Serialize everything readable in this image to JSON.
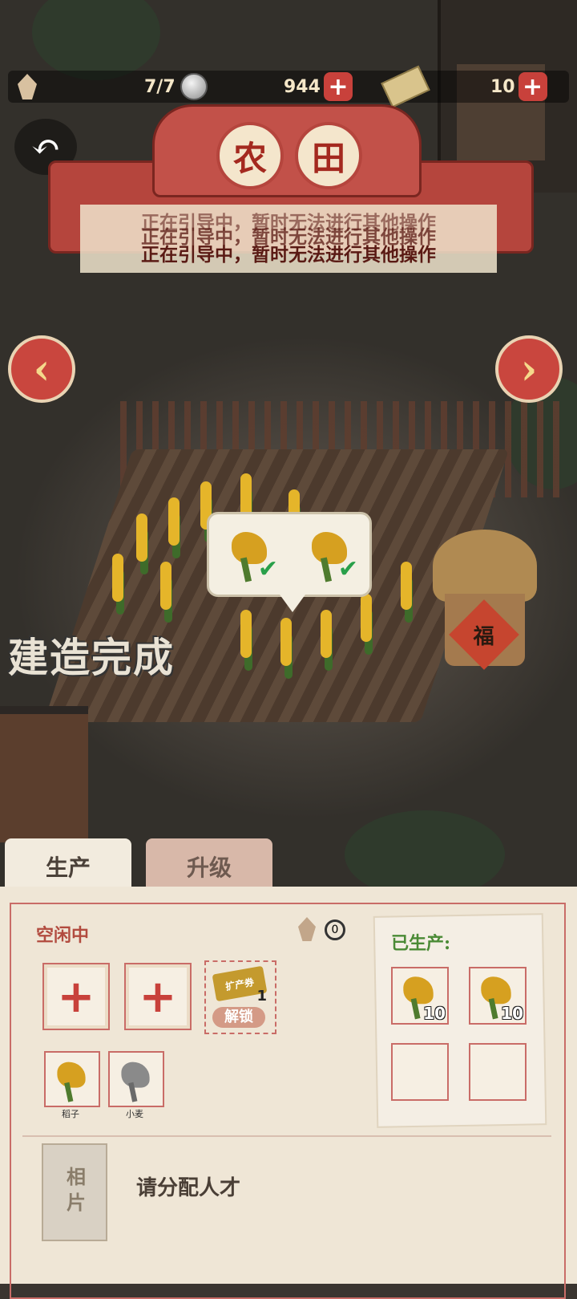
{
  "header": {
    "stamina": "7/7",
    "coins": "944",
    "tickets": "10"
  },
  "title": [
    "农",
    "田"
  ],
  "guide_text": "正在引导中，暂时无法进行其他操作",
  "build_status": "建造完成",
  "hut_sign": "福",
  "tabs": [
    {
      "label": "生产",
      "active": true
    },
    {
      "label": "升级",
      "active": false
    }
  ],
  "production": {
    "status": "空闲中",
    "workers": "0",
    "add_slots": [
      "+",
      "+"
    ],
    "unlock_ticket": "扩产券",
    "unlock_count": "1",
    "unlock_label": "解锁",
    "seeds": [
      {
        "label": "稻子",
        "icon": "rice-icon"
      },
      {
        "label": "小麦",
        "icon": "wheat-icon"
      }
    ]
  },
  "produced": {
    "title": "已生产:",
    "items": [
      {
        "icon": "rice-bundle-icon",
        "count": "10"
      },
      {
        "icon": "rice-bundle-icon",
        "count": "10"
      },
      {
        "icon": "empty",
        "count": ""
      },
      {
        "icon": "empty",
        "count": ""
      }
    ]
  },
  "talent": {
    "photo_label": "相片",
    "prompt": "请分配人才"
  },
  "colors": {
    "accent_red": "#c8413b",
    "success_green": "#29a04a",
    "panel_bg": "#efe6d6"
  }
}
